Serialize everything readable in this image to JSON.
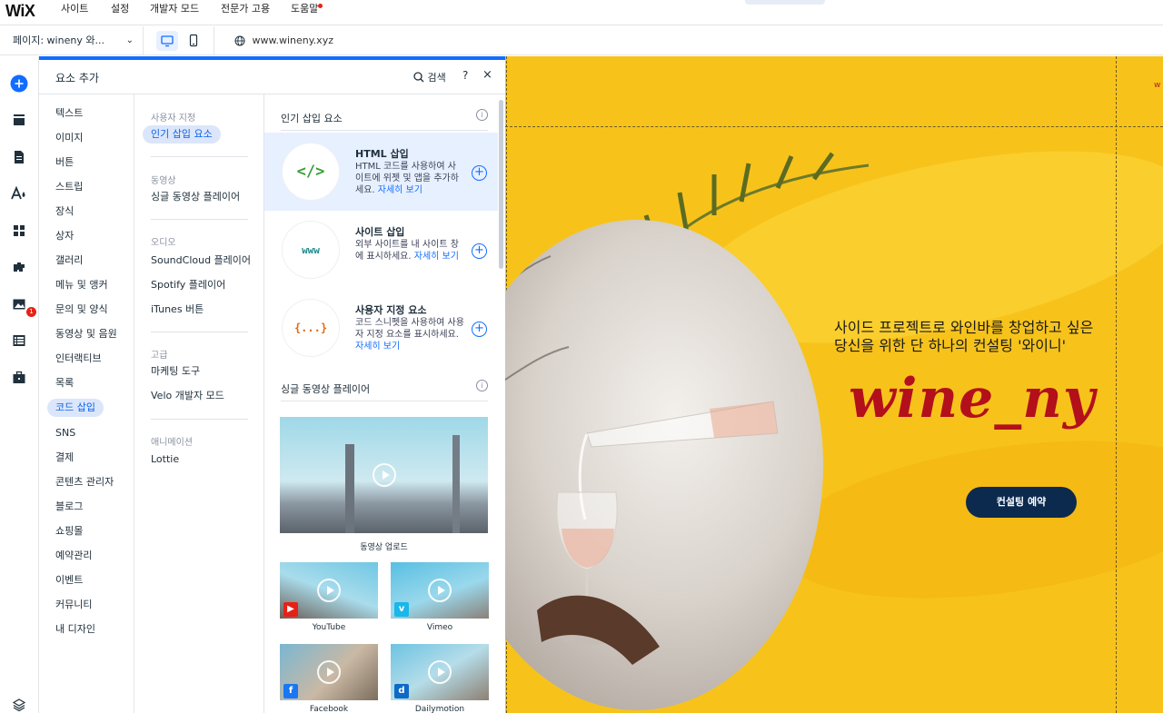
{
  "topbar": {
    "logo": "WiX",
    "menu": [
      "사이트",
      "설정",
      "개발자 모드",
      "전문가 고용",
      "도움말"
    ]
  },
  "bar2": {
    "page_select": "페이지: wineny 와...",
    "url": "www.wineny.xyz"
  },
  "rail": {
    "badge": "1",
    "icons": [
      "add-icon",
      "sections-icon",
      "pages-icon",
      "design-icon",
      "apps-icon",
      "app-market-icon",
      "media-icon",
      "cms-icon",
      "business-icon",
      "layers-icon"
    ]
  },
  "panel": {
    "title": "요소 추가",
    "search_label": "검색",
    "help": "?",
    "close": "×",
    "categories": [
      "텍스트",
      "이미지",
      "버튼",
      "스트립",
      "장식",
      "상자",
      "갤러리",
      "메뉴 및 앵커",
      "문의 및 양식",
      "동영상 및 음원",
      "인터랙티브",
      "목록",
      "코드 삽입",
      "SNS",
      "결제",
      "콘텐츠 관리자",
      "블로그",
      "쇼핑몰",
      "예약관리",
      "이벤트",
      "커뮤니티",
      "내 디자인"
    ],
    "subgroups": {
      "custom_h": "사용자 지정",
      "custom_item": "인기 삽입 요소",
      "video_h": "동영상",
      "video_item": "싱글 동영상 플레이어",
      "audio_h": "오디오",
      "audio_items": [
        "SoundCloud 플레이어",
        "Spotify 플레이어",
        "iTunes 버튼"
      ],
      "advanced_h": "고급",
      "advanced_items": [
        "마케팅 도구",
        "Velo 개발자 모드"
      ],
      "anim_h": "애니메이션",
      "anim_item": "Lottie"
    },
    "content": {
      "sec1": "인기 삽입 요소",
      "cards": [
        {
          "icon": "</>",
          "title": "HTML 삽입",
          "desc": "HTML 코드를 사용하여 사이트에 위젯 및 앱을 추가하세요.",
          "link": "자세히 보기"
        },
        {
          "icon": "www",
          "title": "사이트 삽입",
          "desc": "외부 사이트를 내 사이트 창에 표시하세요.",
          "link": "자세히 보기"
        },
        {
          "icon": "{...}",
          "title": "사용자 지정 요소",
          "desc": "코드 스니펫을 사용하여 사용자 지정 요소를 표시하세요.",
          "link": "자세히 보기"
        }
      ],
      "sec2": "싱글 동영상 플레이어",
      "videos": [
        "동영상 업로드",
        "YouTube",
        "Vimeo",
        "Facebook",
        "Dailymotion"
      ]
    }
  },
  "canvas": {
    "corner_text": "w",
    "headline_1": "사이드 프로젝트로 와인바를 창업하고 싶은",
    "headline_2": "당신을 위한 단 하나의 컨설팅 '와이니'",
    "brand": "wine_ny",
    "cta": "컨설팅 예약"
  },
  "colors": {
    "accent": "#116dff",
    "canvas_bg": "#f7c31b",
    "brand": "#b3101b",
    "cta_bg": "#0c2a4e"
  }
}
